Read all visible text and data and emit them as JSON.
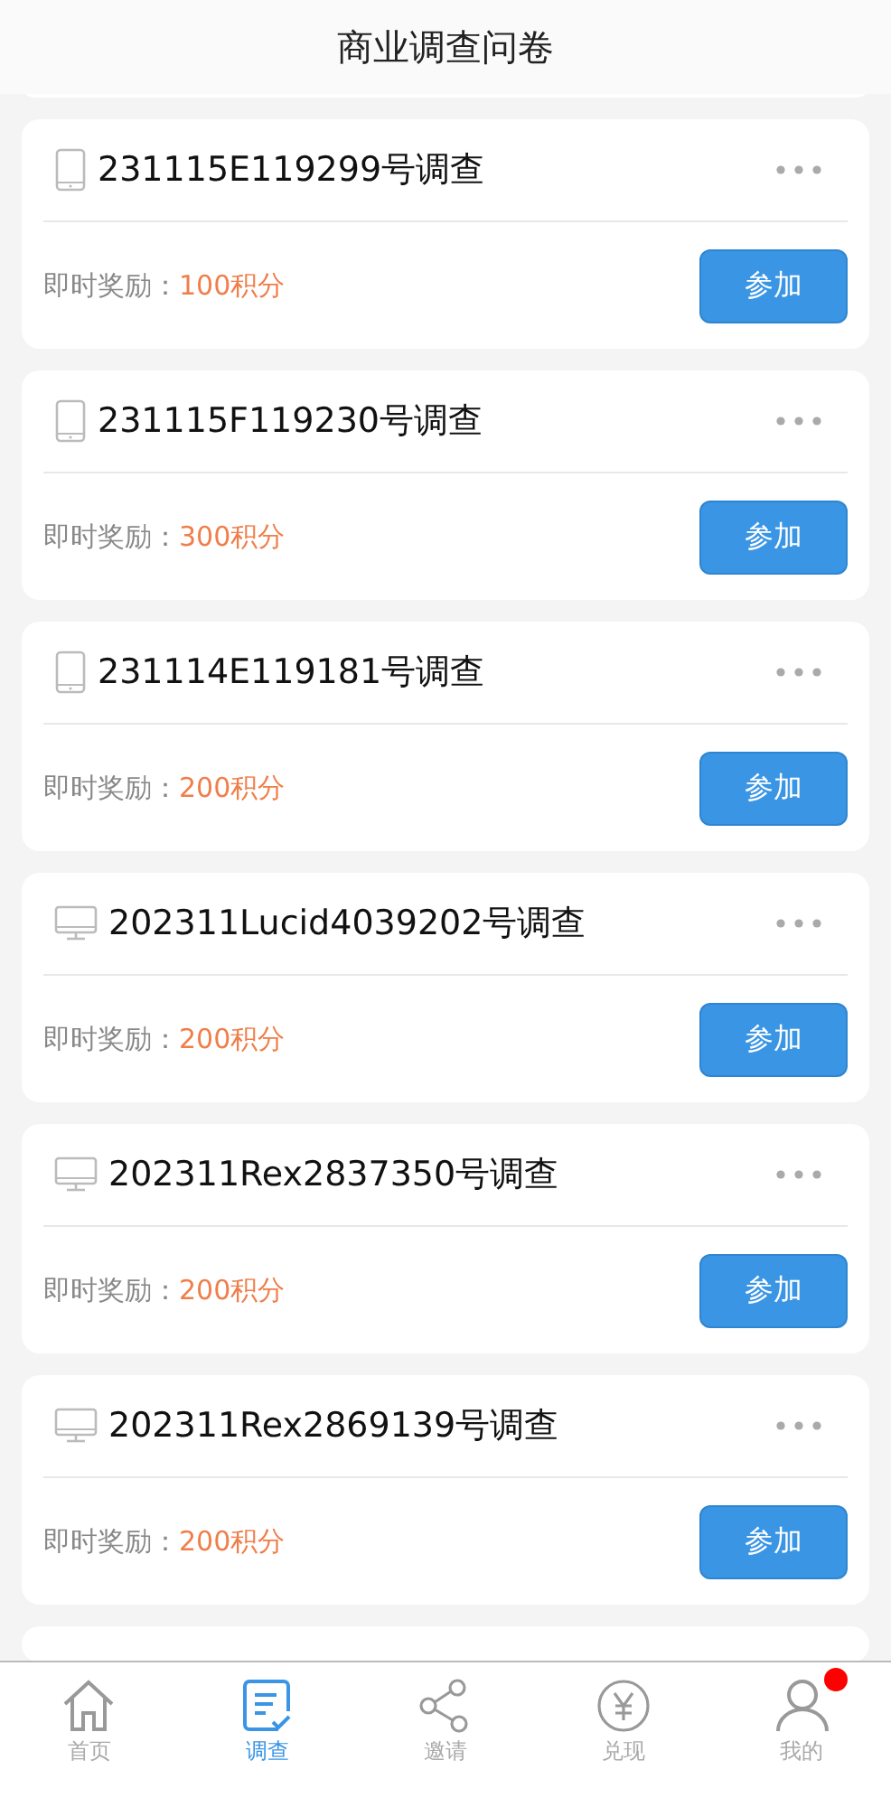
{
  "header": {
    "title": "商业调查问卷"
  },
  "surveys": [
    {
      "kind": "phone",
      "title": "231115E119299号调查",
      "reward_label": "即时奖励：",
      "reward_value": "100积分",
      "button": "参加"
    },
    {
      "kind": "phone",
      "title": "231115F119230号调查",
      "reward_label": "即时奖励：",
      "reward_value": "300积分",
      "button": "参加"
    },
    {
      "kind": "phone",
      "title": "231114E119181号调查",
      "reward_label": "即时奖励：",
      "reward_value": "200积分",
      "button": "参加"
    },
    {
      "kind": "desktop",
      "title": "202311Lucid4039202号调查",
      "reward_label": "即时奖励：",
      "reward_value": "200积分",
      "button": "参加"
    },
    {
      "kind": "desktop",
      "title": "202311Rex2837350号调查",
      "reward_label": "即时奖励：",
      "reward_value": "200积分",
      "button": "参加"
    },
    {
      "kind": "desktop",
      "title": "202311Rex2869139号调查",
      "reward_label": "即时奖励：",
      "reward_value": "200积分",
      "button": "参加"
    }
  ],
  "nav": [
    {
      "kind": "home",
      "label": "首页",
      "selected": false,
      "badge": false
    },
    {
      "kind": "survey",
      "label": "调查",
      "selected": true,
      "badge": false
    },
    {
      "kind": "share",
      "label": "邀请",
      "selected": false,
      "badge": false
    },
    {
      "kind": "yen",
      "label": "兑现",
      "selected": false,
      "badge": false
    },
    {
      "kind": "user",
      "label": "我的",
      "selected": false,
      "badge": true
    }
  ]
}
